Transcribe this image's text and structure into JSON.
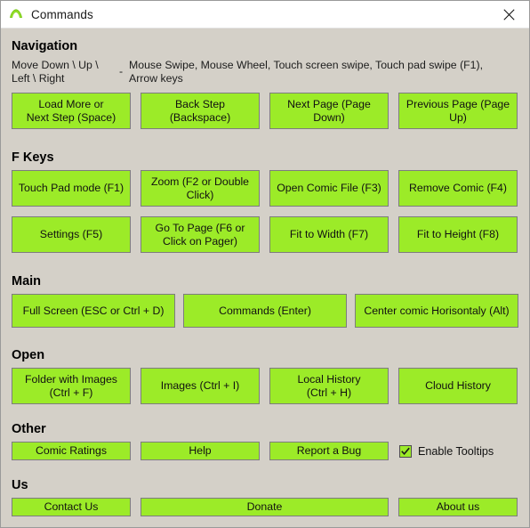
{
  "window": {
    "title": "Commands",
    "app_icon": "mountain-arch-icon",
    "close_icon": "close-icon",
    "accent_color": "#9ceb28",
    "background_color": "#d4d0c8",
    "titlebar_color": "#ffffff"
  },
  "sections": [
    {
      "id": "navigation",
      "title": "Navigation",
      "label": "Move Down \\ Up \\\nLeft \\ Right",
      "separator": "-",
      "description": "Mouse Swipe, Mouse Wheel, Touch screen swipe, Touch pad swipe (F1),\nArrow keys",
      "buttons": [
        "Load More or\nNext Step (Space)",
        "Back Step\n(Backspace)",
        "Next Page (Page\nDown)",
        "Previous Page (Page\nUp)"
      ]
    },
    {
      "id": "f-keys",
      "title": "F Keys",
      "buttons": [
        "Touch Pad mode (F1)",
        "Zoom (F2 or Double\nClick)",
        "Open Comic File (F3)",
        "Remove Comic (F4)",
        "Settings (F5)",
        "Go To Page (F6 or\nClick on Pager)",
        "Fit to Width (F7)",
        "Fit to Height (F8)"
      ]
    },
    {
      "id": "main",
      "title": "Main",
      "buttons": [
        "Full Screen (ESC or Ctrl + D)",
        "Commands (Enter)",
        "Center comic Horisontaly (Alt)"
      ]
    },
    {
      "id": "open",
      "title": "Open",
      "buttons": [
        "Folder with Images\n(Ctrl + F)",
        "Images (Ctrl + I)",
        "Local History\n(Ctrl + H)",
        "Cloud History"
      ]
    },
    {
      "id": "other",
      "title": "Other",
      "buttons": [
        "Comic Ratings",
        "Help",
        "Report a Bug"
      ],
      "checkbox": {
        "label": "Enable Tooltips",
        "checked": true
      }
    },
    {
      "id": "us",
      "title": "Us",
      "buttons": [
        "Contact Us",
        "Donate",
        "About us"
      ]
    }
  ]
}
